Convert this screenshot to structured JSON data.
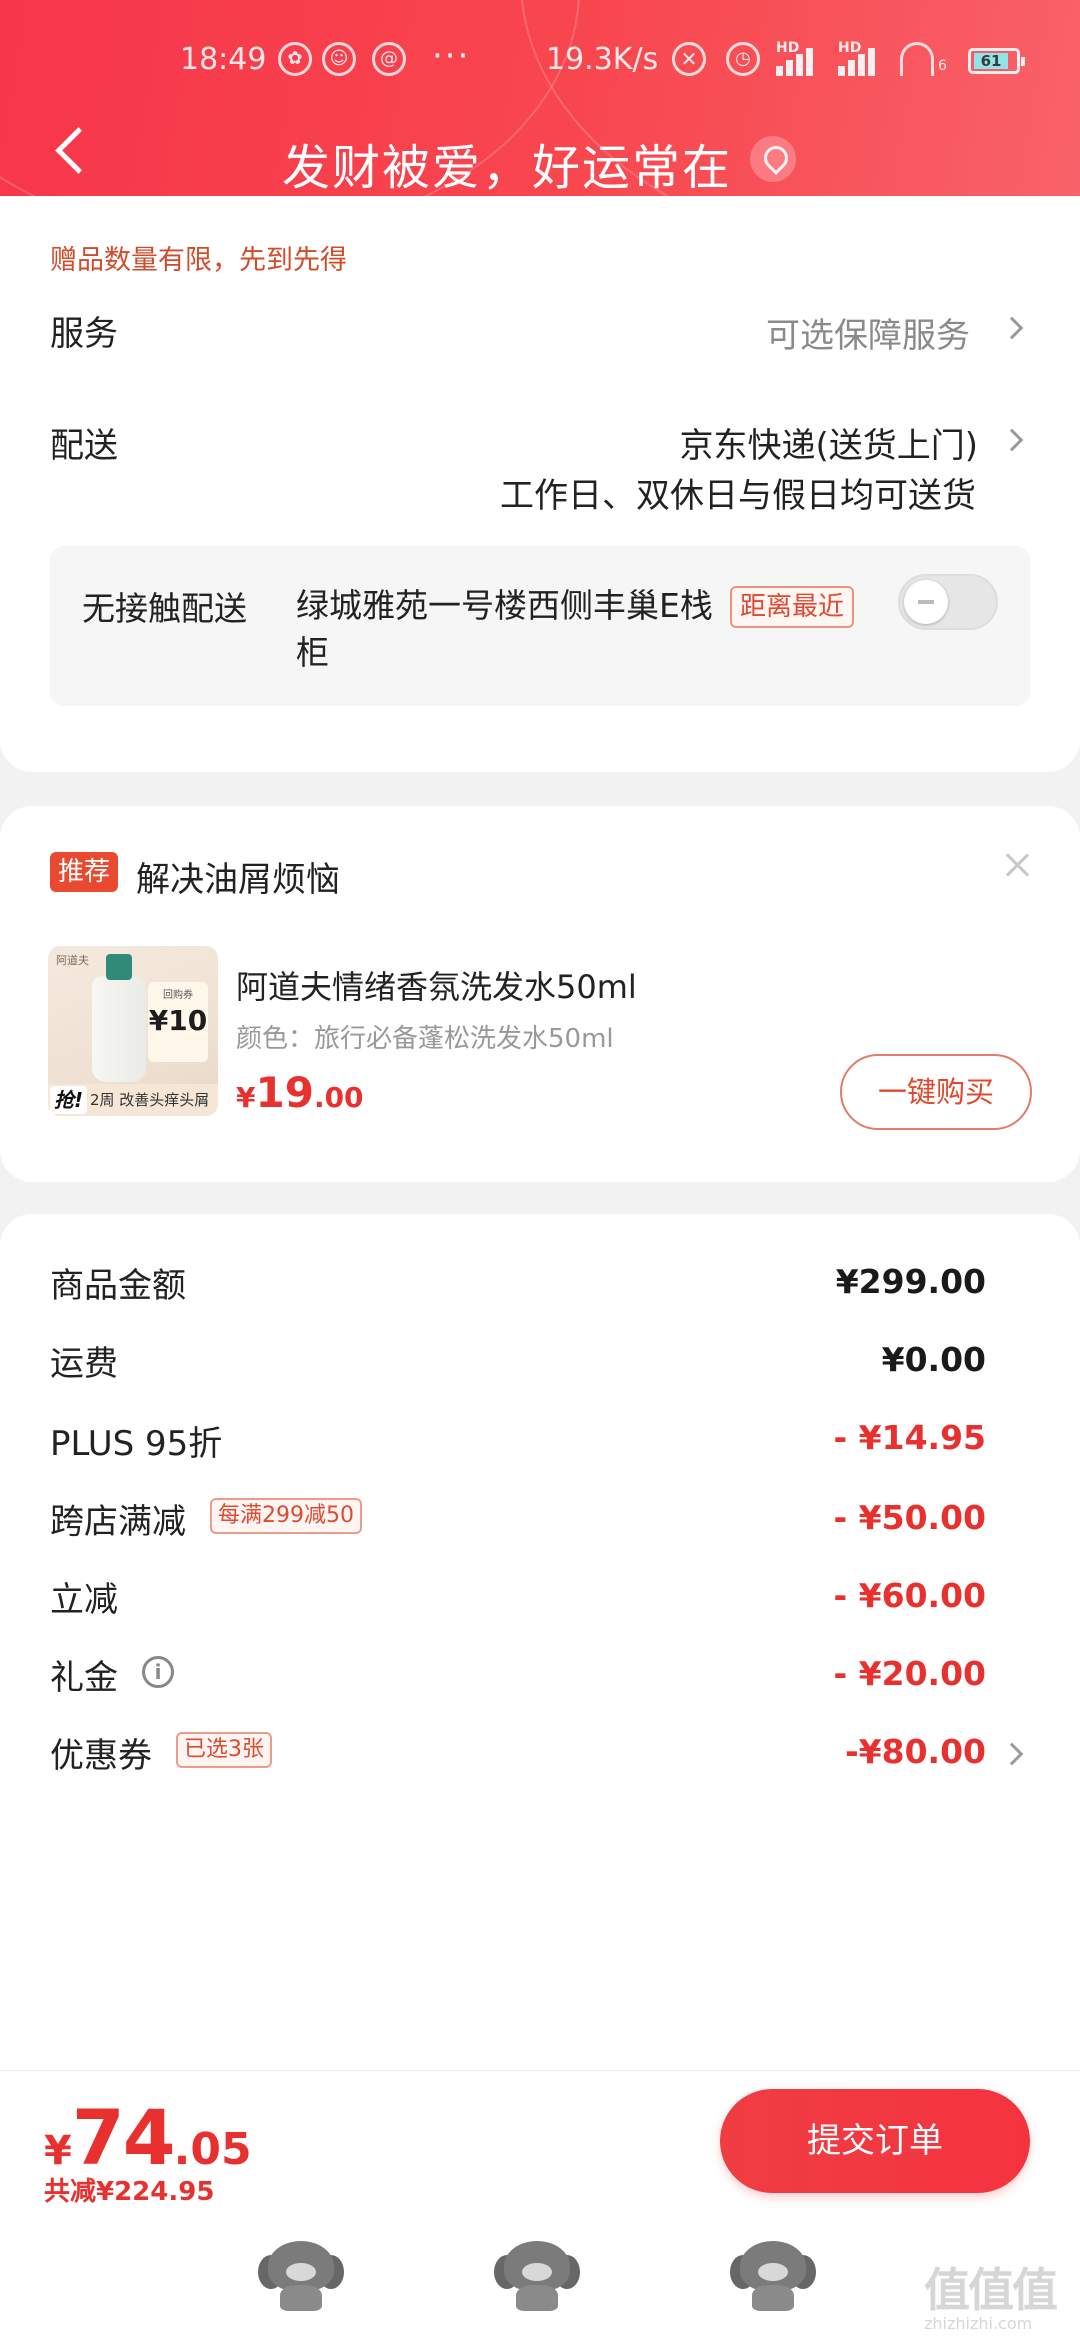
{
  "status_bar": {
    "time": "18:49",
    "more": "···",
    "net_speed": "19.3K/s",
    "hd_label": "HD",
    "wifi_sub": "6",
    "battery": "61"
  },
  "header": {
    "title": "发财被爱，好运常在"
  },
  "delivery_card": {
    "gift_note": "赠品数量有限，先到先得",
    "service_label": "服务",
    "service_value": "可选保障服务",
    "delivery_label": "配送",
    "delivery_method": "京东快递(送货上门)",
    "delivery_days": "工作日、双休日与假日均可送货",
    "contactless": {
      "label": "无接触配送",
      "address": "绿城雅苑一号楼西侧丰巢E栈柜",
      "badge": "距离最近",
      "enabled": false
    }
  },
  "recommend": {
    "tag": "推荐",
    "title": "解决油屑烦恼",
    "product": {
      "name": "阿道夫情绪香氛洗发水50ml",
      "color": "颜色：旅行必备蓬松洗发水50ml",
      "price_symbol": "¥",
      "price_int": "19",
      "price_dec": ".00",
      "buy_label": "一键购买",
      "image_text": {
        "brand": "阿道夫",
        "promo_top": "回购券",
        "promo_value": "¥10",
        "grab": "抢!",
        "strip": "2周 改善头痒头屑"
      }
    }
  },
  "summary": {
    "rows": [
      {
        "label": "商品金额",
        "value": "¥299.00"
      },
      {
        "label": "运费",
        "value": "¥0.00"
      },
      {
        "label": "PLUS 95折",
        "value": "- ¥14.95"
      },
      {
        "label": "跨店满减",
        "tag": "每满299减50",
        "value": "- ¥50.00"
      },
      {
        "label": "立减",
        "value": "- ¥60.00"
      },
      {
        "label": "礼金",
        "info_icon": "i",
        "value": "- ¥20.00"
      },
      {
        "label": "优惠券",
        "tag": "已选3张",
        "value": "-¥80.00"
      }
    ]
  },
  "footer": {
    "total_symbol": "¥",
    "total_int": "74",
    "total_dec": ".05",
    "saved": "共减¥224.95",
    "submit": "提交订单"
  },
  "watermark": {
    "logo": "值值值",
    "site": "zhizhizhi.com"
  },
  "colors": {
    "header_red": "#f7364a",
    "price_red": "#e8312f",
    "tag_orange": "#e0492f"
  }
}
